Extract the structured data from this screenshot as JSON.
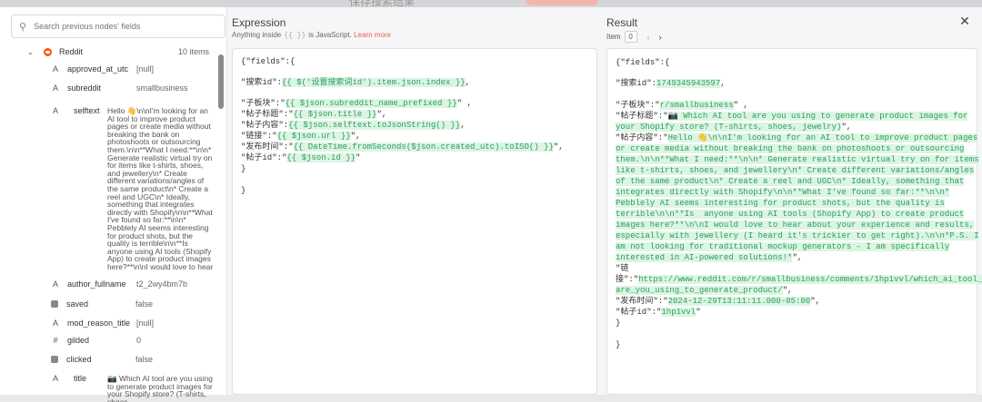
{
  "backdrop": {
    "ghost_text": "保存搜索结果"
  },
  "left": {
    "search_placeholder": "Search previous nodes' fields",
    "node": {
      "name": "Reddit",
      "count": "10 items"
    },
    "fields": [
      {
        "type": "A",
        "key": "approved_at_utc",
        "value": "[null]"
      },
      {
        "type": "A",
        "key": "subreddit",
        "value": "smallbusiness"
      },
      {
        "type": "A",
        "key": "selftext",
        "value": "Hello 👋\\n\\nI'm looking for an AI tool to improve product pages or create media without breaking the bank on photoshoots or outsourcing them.\\n\\n**What I need:**\\n\\n* Generate realistic virtual try on for items like t-shirts, shoes, and jewellery\\n* Create different variations/angles of the same product\\n* Create a reel and UGC\\n* Ideally, something that integrates directly with Shopify\\n\\n**What I've found so far:**\\n\\n* Pebblely AI seems interesting for product shots, but the quality is terrible\\n\\n**Is anyone using AI tools (Shopify App) to create product images here?**\\n\\nI would love to hear about your ex..."
      },
      {
        "type": "A",
        "key": "author_fullname",
        "value": "t2_2wy4bm7b"
      },
      {
        "type": "box",
        "key": "saved",
        "value": "false"
      },
      {
        "type": "A",
        "key": "mod_reason_title",
        "value": "[null]"
      },
      {
        "type": "#",
        "key": "gilded",
        "value": "0"
      },
      {
        "type": "box",
        "key": "clicked",
        "value": "false"
      },
      {
        "type": "A",
        "key": "title",
        "value": "📷 Which AI tool are you using to generate product images for your Shopify store? (T-shirts, shoes,"
      }
    ]
  },
  "expression": {
    "title": "Expression",
    "sub_before": "Anything inside",
    "sub_code": "{{ }}",
    "sub_after": "is JavaScript.",
    "learn_more": "Learn more",
    "lines": [
      {
        "plain": "{\"fields\":{",
        "hl": "",
        "after": ""
      },
      {
        "plain": "\"搜索id\":",
        "hl": "{{ $('设置搜索词id').item.json.index }}",
        "after": ","
      },
      {
        "plain": "\"子板块\":\"",
        "hl": "{{ $json.subreddit_name_prefixed }}",
        "after": "\" ,"
      },
      {
        "plain": "\"帖子标题\":\"",
        "hl": "{{ $json.title }}",
        "after": "\","
      },
      {
        "plain": "\"帖子内容\":",
        "hl": "{{ $json.selftext.toJsonString() }}",
        "after": ","
      },
      {
        "plain": "\"链接\":\"",
        "hl": "{{ $json.url }}",
        "after": "\","
      },
      {
        "plain": "\"发布时间\":\"",
        "hl": "{{ DateTime.fromSeconds($json.created_utc).toISO() }}",
        "after": "\","
      },
      {
        "plain": "\"帖子id\":\"",
        "hl": "{{ $json.id }}",
        "after": "\""
      },
      {
        "plain": "}",
        "hl": "",
        "after": ""
      },
      {
        "plain": "}",
        "hl": "",
        "after": ""
      }
    ]
  },
  "result": {
    "title": "Result",
    "item_label": "Item",
    "item_value": "0",
    "prev": "‹",
    "next": "›",
    "lines": [
      {
        "plain": "{\"fields\":{",
        "hl": "",
        "after": ""
      },
      {
        "plain": "\"搜索id\":",
        "hl": "1749345943597",
        "after": ","
      },
      {
        "plain": "\"子板块\":\"",
        "hl": "r/smallbusiness",
        "after": "\" ,"
      },
      {
        "plain": "\"帖子标题\":\"",
        "hl": "📷 Which AI tool are you using to generate product images for",
        "after": ""
      },
      {
        "plain": "",
        "hl": "your Shopify store? (T-shirts, shoes, jewelry)",
        "after": "\","
      },
      {
        "plain": "\"帖子内容\":\"",
        "hl": "Hello 👋\\n\\nI'm looking for an AI tool to improve product pages",
        "after": ""
      },
      {
        "plain": "",
        "hl": "or create media without breaking the bank on photoshoots or outsourcing",
        "after": ""
      },
      {
        "plain": "",
        "hl": "them.\\n\\n**What I need:**\\n\\n* Generate realistic virtual try on for items",
        "after": ""
      },
      {
        "plain": "",
        "hl": "like t-shirts, shoes, and jewellery\\n* Create different variations/angles",
        "after": ""
      },
      {
        "plain": "",
        "hl": "of the same product\\n* Create a reel and UGC\\n* Ideally, something that",
        "after": ""
      },
      {
        "plain": "",
        "hl": "integrates directly with Shopify\\n\\n**What I've found so far:**\\n\\n*",
        "after": ""
      },
      {
        "plain": "",
        "hl": "Pebblely AI seems interesting for product shots, but the quality is",
        "after": ""
      },
      {
        "plain": "",
        "hl": "terrible\\n\\n**Is  anyone using AI tools (Shopify App) to create product",
        "after": ""
      },
      {
        "plain": "",
        "hl": "images here?**\\n\\nI would love to hear about your experience and results,",
        "after": ""
      },
      {
        "plain": "",
        "hl": "especially with jewellery (I heard it's trickier to get right).\\n\\n*P.S. I",
        "after": ""
      },
      {
        "plain": "",
        "hl": "am not looking for traditional mockup generators – I am specifically",
        "after": ""
      },
      {
        "plain": "",
        "hl": "interested in AI-powered solutions!*",
        "after": "\","
      },
      {
        "plain": "\"链",
        "hl": "",
        "after": ""
      },
      {
        "plain": "接\":\"",
        "hl": "https://www.reddit.com/r/smallbusiness/comments/1hp1vvl/which_ai_tool_",
        "after": ""
      },
      {
        "plain": "",
        "hl": "are_you_using_to_generate_product/",
        "after": "\","
      },
      {
        "plain": "\"发布时间\":\"",
        "hl": "2024-12-29T13:11:11.000-05:00",
        "after": "\","
      },
      {
        "plain": "\"帖子id\":\"",
        "hl": "1hp1vvl",
        "after": "\""
      },
      {
        "plain": "}",
        "hl": "",
        "after": ""
      },
      {
        "plain": "}",
        "hl": "",
        "after": ""
      }
    ]
  }
}
